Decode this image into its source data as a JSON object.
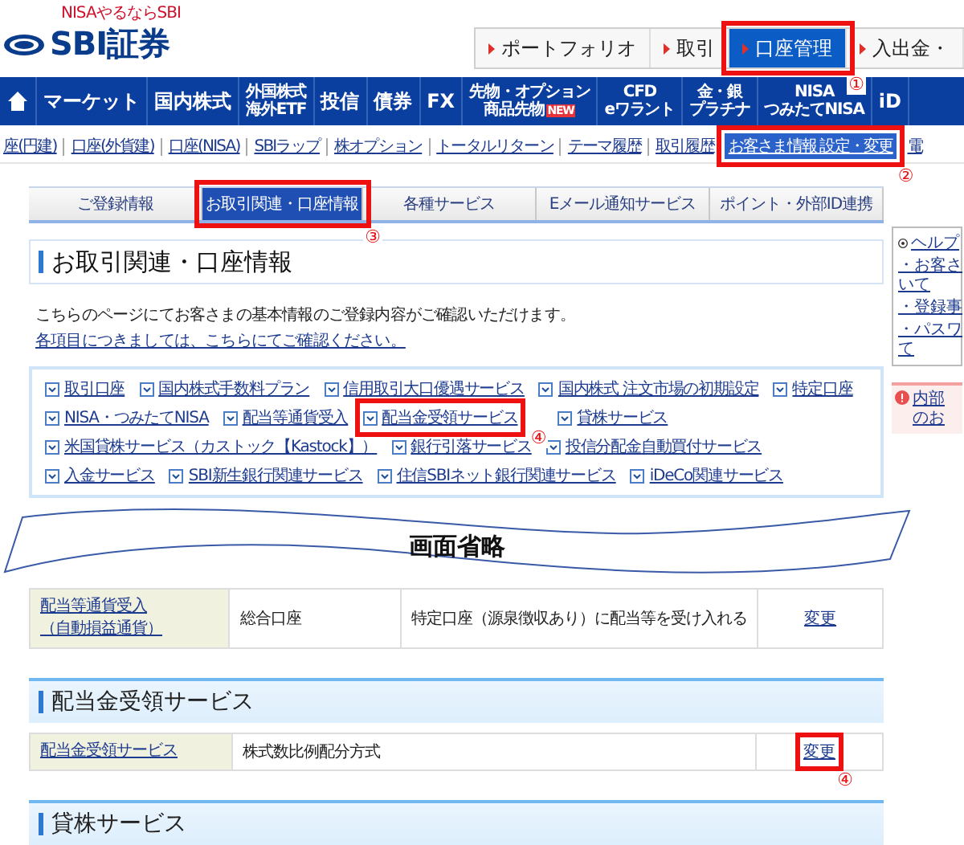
{
  "header": {
    "logo_tagline": "NISAやるならSBI",
    "logo": "SBI証券",
    "top_buttons": [
      {
        "label": "ポートフォリオ",
        "selected": false
      },
      {
        "label": "取引",
        "selected": false
      },
      {
        "label": "口座管理",
        "selected": true,
        "callout": "①"
      },
      {
        "label": "入出金・",
        "selected": false
      }
    ]
  },
  "nav": [
    {
      "label": "マーケット"
    },
    {
      "label": "国内株式"
    },
    {
      "label": "外国株式",
      "sub": "海外ETF"
    },
    {
      "label": "投信"
    },
    {
      "label": "債券"
    },
    {
      "label": "FX"
    },
    {
      "label": "先物・オプション",
      "sub": "商品先物",
      "badge": "NEW"
    },
    {
      "label": "CFD",
      "sub": "eワラント"
    },
    {
      "label": "金・銀",
      "sub": "プラチナ"
    },
    {
      "label": "NISA",
      "sub": "つみたてNISA"
    },
    {
      "label": "iD"
    }
  ],
  "subnav": [
    {
      "label": "座(円建)",
      "selected": false
    },
    {
      "label": "口座(外貨建)",
      "selected": false
    },
    {
      "label": "口座(NISA)",
      "selected": false
    },
    {
      "label": "SBIラップ",
      "selected": false
    },
    {
      "label": "株オプション",
      "selected": false
    },
    {
      "label": "トータルリターン",
      "selected": false
    },
    {
      "label": "テーマ履歴",
      "selected": false
    },
    {
      "label": "取引履歴",
      "selected": false
    },
    {
      "label": "お客さま情報 設定・変更",
      "selected": true,
      "callout": "②"
    },
    {
      "label": "電",
      "selected": false
    }
  ],
  "tabs": [
    {
      "label": "ご登録情報",
      "selected": false
    },
    {
      "label": "お取引関連・口座情報",
      "selected": true,
      "callout": "③"
    },
    {
      "label": "各種サービス",
      "selected": false
    },
    {
      "label": "Eメール通知サービス",
      "selected": false
    },
    {
      "label": "ポイント・外部ID連携",
      "selected": false
    }
  ],
  "page_title": "お取引関連・口座情報",
  "intro": "こちらのページにてお客さまの基本情報のご登録内容がご確認いただけます。",
  "intro_link": "各項目につきましては、こちらにてご確認ください。",
  "service_links": [
    {
      "label": "取引口座"
    },
    {
      "label": "国内株式手数料プラン"
    },
    {
      "label": "信用取引大口優遇サービス"
    },
    {
      "label": "国内株式 注文市場の初期設定"
    },
    {
      "label": "特定口座"
    },
    {
      "label": "NISA・つみたてNISA"
    },
    {
      "label": "配当等通貨受入"
    },
    {
      "label": "配当金受領サービス",
      "callout": "④"
    },
    {
      "label": "貸株サービス"
    },
    {
      "label": "米国貸株サービス（カストック【Kastock】）"
    },
    {
      "label": "銀行引落サービス"
    },
    {
      "label": "投信分配金自動買付サービス"
    },
    {
      "label": "入金サービス"
    },
    {
      "label": "SBI新生銀行関連サービス"
    },
    {
      "label": "住信SBIネット銀行関連サービス"
    },
    {
      "label": "iDeCo関連サービス"
    }
  ],
  "omission_banner": "画面省略",
  "sections": [
    {
      "rows": [
        {
          "item_lines": [
            "配当等通貨受入",
            "（自動損益通貨）"
          ],
          "account": "総合口座",
          "setting": "特定口座（源泉徴収あり）に配当等を受け入れる",
          "action": "変更"
        }
      ]
    },
    {
      "title": "配当金受領サービス",
      "rows": [
        {
          "item_lines": [
            "配当金受領サービス"
          ],
          "setting": "株式数比例配分方式",
          "action": "変更",
          "callout": "④"
        }
      ]
    },
    {
      "title": "貸株サービス"
    }
  ],
  "sidebar": {
    "help_title": "ヘルプ",
    "help_items": [
      {
        "bullet": "・",
        "lines": [
          "お客さ",
          "いて"
        ]
      },
      {
        "bullet": "・",
        "lines": [
          "登録事"
        ]
      },
      {
        "bullet": "・",
        "lines": [
          "パスワ",
          "て"
        ]
      }
    ],
    "notice_lines": [
      "内部",
      "のお"
    ]
  }
}
